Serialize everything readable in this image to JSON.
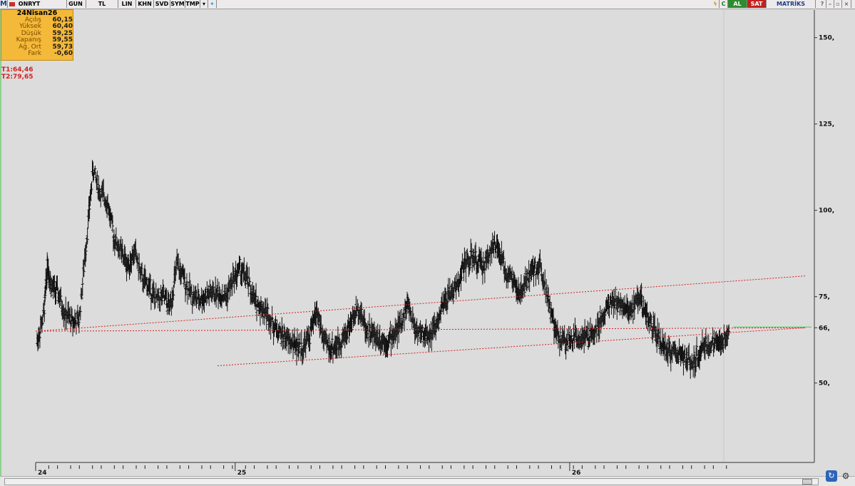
{
  "toolbar": {
    "logo": "M",
    "symbol": "ONRYT",
    "period": "GUN",
    "currency": "TL",
    "buttons": [
      "LIN",
      "KHN",
      "SVD",
      "SYM",
      "TMP"
    ],
    "buy": "AL",
    "sell": "SAT",
    "brand": "MATRİKS",
    "icons": [
      "lightning-icon",
      "refresh-icon",
      "dropdown-icon",
      "twitter-bird-icon",
      "help-icon",
      "minimize-icon",
      "restore-icon",
      "close-icon"
    ]
  },
  "info_box": {
    "date": "24Nisan26",
    "rows": [
      {
        "label": "Açılış",
        "value": "60,15"
      },
      {
        "label": "Yüksek",
        "value": "60,40"
      },
      {
        "label": "Düşük",
        "value": "59,25"
      },
      {
        "label": "Kapanış",
        "value": "59,55"
      },
      {
        "label": "Ağ. Ort",
        "value": "59,73"
      },
      {
        "label": "Fark",
        "value": "-0,60"
      }
    ]
  },
  "targets": {
    "t1": "T1:64,46",
    "t2": "T2:79,65"
  },
  "colors": {
    "bars": "#111111",
    "trendlines": "#d42020",
    "level_line": "#3ecf3e",
    "info_bg": "#f5b93a",
    "background": "#dcdcdc"
  },
  "chart_data": {
    "type": "ohlc",
    "y_ticks": [
      {
        "value": 150,
        "label": "150,"
      },
      {
        "value": 125,
        "label": "125,"
      },
      {
        "value": 100,
        "label": "100,"
      },
      {
        "value": 75,
        "label": "75,"
      },
      {
        "value": 66,
        "label": "66,"
      },
      {
        "value": 50,
        "label": "50,"
      }
    ],
    "ylim": [
      27,
      158
    ],
    "x_ticks": [
      {
        "pos": 0.0,
        "label": "24"
      },
      {
        "pos": 0.34,
        "label": "25"
      },
      {
        "pos": 0.91,
        "label": "26"
      }
    ],
    "price_path": [
      [
        0.0,
        62
      ],
      [
        0.01,
        70
      ],
      [
        0.015,
        85
      ],
      [
        0.02,
        78
      ],
      [
        0.03,
        76
      ],
      [
        0.04,
        70
      ],
      [
        0.05,
        68
      ],
      [
        0.06,
        68
      ],
      [
        0.07,
        90
      ],
      [
        0.08,
        112
      ],
      [
        0.09,
        105
      ],
      [
        0.1,
        103
      ],
      [
        0.11,
        92
      ],
      [
        0.12,
        88
      ],
      [
        0.13,
        84
      ],
      [
        0.14,
        88
      ],
      [
        0.15,
        80
      ],
      [
        0.16,
        78
      ],
      [
        0.17,
        74
      ],
      [
        0.18,
        75
      ],
      [
        0.19,
        72
      ],
      [
        0.2,
        84
      ],
      [
        0.21,
        80
      ],
      [
        0.22,
        76
      ],
      [
        0.23,
        74
      ],
      [
        0.24,
        75
      ],
      [
        0.25,
        76
      ],
      [
        0.26,
        76
      ],
      [
        0.27,
        75
      ],
      [
        0.28,
        80
      ],
      [
        0.29,
        83
      ],
      [
        0.3,
        80
      ],
      [
        0.31,
        74
      ],
      [
        0.32,
        72
      ],
      [
        0.33,
        70
      ],
      [
        0.34,
        66
      ],
      [
        0.35,
        64
      ],
      [
        0.36,
        62
      ],
      [
        0.37,
        61
      ],
      [
        0.38,
        60
      ],
      [
        0.39,
        64
      ],
      [
        0.4,
        71
      ],
      [
        0.41,
        62
      ],
      [
        0.42,
        60
      ],
      [
        0.43,
        61
      ],
      [
        0.44,
        64
      ],
      [
        0.45,
        68
      ],
      [
        0.46,
        72
      ],
      [
        0.47,
        66
      ],
      [
        0.48,
        64
      ],
      [
        0.49,
        63
      ],
      [
        0.5,
        62
      ],
      [
        0.51,
        64
      ],
      [
        0.52,
        67
      ],
      [
        0.53,
        73
      ],
      [
        0.54,
        66
      ],
      [
        0.55,
        64
      ],
      [
        0.56,
        64
      ],
      [
        0.57,
        66
      ],
      [
        0.58,
        72
      ],
      [
        0.59,
        76
      ],
      [
        0.6,
        78
      ],
      [
        0.61,
        84
      ],
      [
        0.62,
        86
      ],
      [
        0.63,
        85
      ],
      [
        0.64,
        84
      ],
      [
        0.65,
        90
      ],
      [
        0.66,
        88
      ],
      [
        0.67,
        82
      ],
      [
        0.68,
        80
      ],
      [
        0.69,
        75
      ],
      [
        0.7,
        80
      ],
      [
        0.71,
        83
      ],
      [
        0.72,
        84
      ],
      [
        0.73,
        75
      ],
      [
        0.74,
        65
      ],
      [
        0.75,
        62
      ],
      [
        0.76,
        62
      ],
      [
        0.77,
        64
      ],
      [
        0.78,
        63
      ],
      [
        0.79,
        63
      ],
      [
        0.8,
        66
      ],
      [
        0.81,
        70
      ],
      [
        0.82,
        74
      ],
      [
        0.83,
        73
      ],
      [
        0.84,
        72
      ],
      [
        0.85,
        70
      ],
      [
        0.86,
        76
      ],
      [
        0.87,
        70
      ],
      [
        0.88,
        66
      ],
      [
        0.89,
        62
      ],
      [
        0.9,
        59
      ],
      [
        0.91,
        59
      ],
      [
        0.92,
        58
      ],
      [
        0.93,
        56
      ],
      [
        0.94,
        57
      ],
      [
        0.95,
        60
      ],
      [
        0.96,
        61
      ],
      [
        0.97,
        61
      ],
      [
        0.98,
        62
      ],
      [
        0.99,
        66
      ]
    ],
    "trendlines": [
      {
        "name": "upper",
        "from": [
          0.0,
          65
        ],
        "to": [
          1.1,
          81
        ]
      },
      {
        "name": "lower",
        "from": [
          0.26,
          55
        ],
        "to": [
          1.1,
          66
        ]
      },
      {
        "name": "middle",
        "from": [
          0.0,
          65
        ],
        "to": [
          1.1,
          66
        ]
      }
    ],
    "level": {
      "value": 66
    }
  }
}
